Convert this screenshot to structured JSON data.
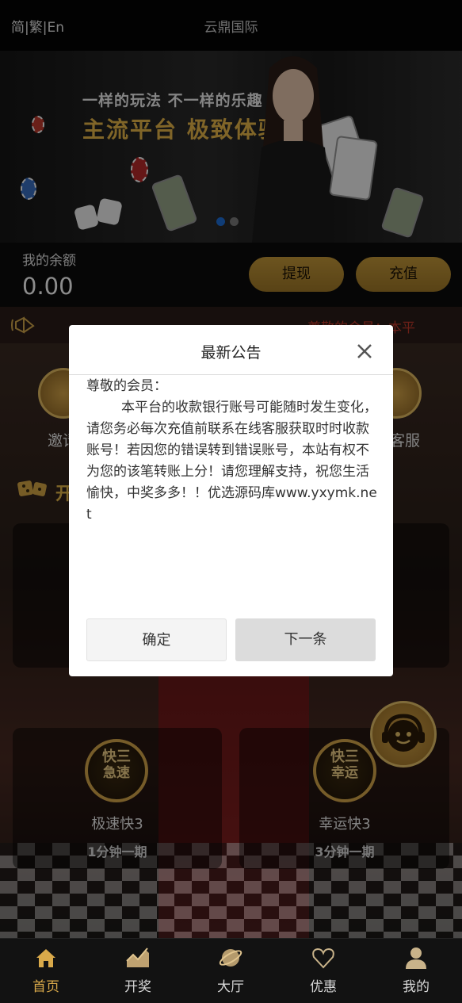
{
  "header": {
    "lang_switch": "简|繁|En",
    "title": "云鼎国际"
  },
  "banner": {
    "line1": "一样的玩法 不一样的乐趣",
    "line2": "主流平台 极致体验"
  },
  "balance": {
    "label": "我的余额",
    "amount": "0.00",
    "withdraw_label": "提现",
    "deposit_label": "充值"
  },
  "notice_bar": {
    "text": "尊敬的会员：本平"
  },
  "quick_links": {
    "left_label": "邀请",
    "right_label": "客服"
  },
  "section": {
    "header": "开"
  },
  "games": [
    {
      "icon_top": "快三",
      "icon_bottom": "急速",
      "name": "极速快3",
      "period": "1分钟一期"
    },
    {
      "icon_top": "快三",
      "icon_bottom": "幸运",
      "name": "幸运快3",
      "period": "3分钟一期"
    }
  ],
  "modal": {
    "title": "最新公告",
    "greeting": "尊敬的会员：",
    "body": "本平台的收款银行账号可能随时发生变化，请您务必每次充值前联系在线客服获取时时收款账号！若因您的错误转到错误账号，本站有权不为您的该笔转账上分！请您理解支持，祝您生活愉快，中奖多多！！优选源码库www.yxymk.net",
    "confirm_label": "确定",
    "next_label": "下一条"
  },
  "tabs": [
    {
      "label": "首页",
      "icon": "home-icon",
      "active": true
    },
    {
      "label": "开奖",
      "icon": "chart-icon",
      "active": false
    },
    {
      "label": "大厅",
      "icon": "planet-icon",
      "active": false
    },
    {
      "label": "优惠",
      "icon": "heart-icon",
      "active": false
    },
    {
      "label": "我的",
      "icon": "user-icon",
      "active": false
    }
  ],
  "colors": {
    "accent_gold": "#c69a3a",
    "active_tab": "#d9a94a",
    "notice_red": "#c43a2a"
  }
}
